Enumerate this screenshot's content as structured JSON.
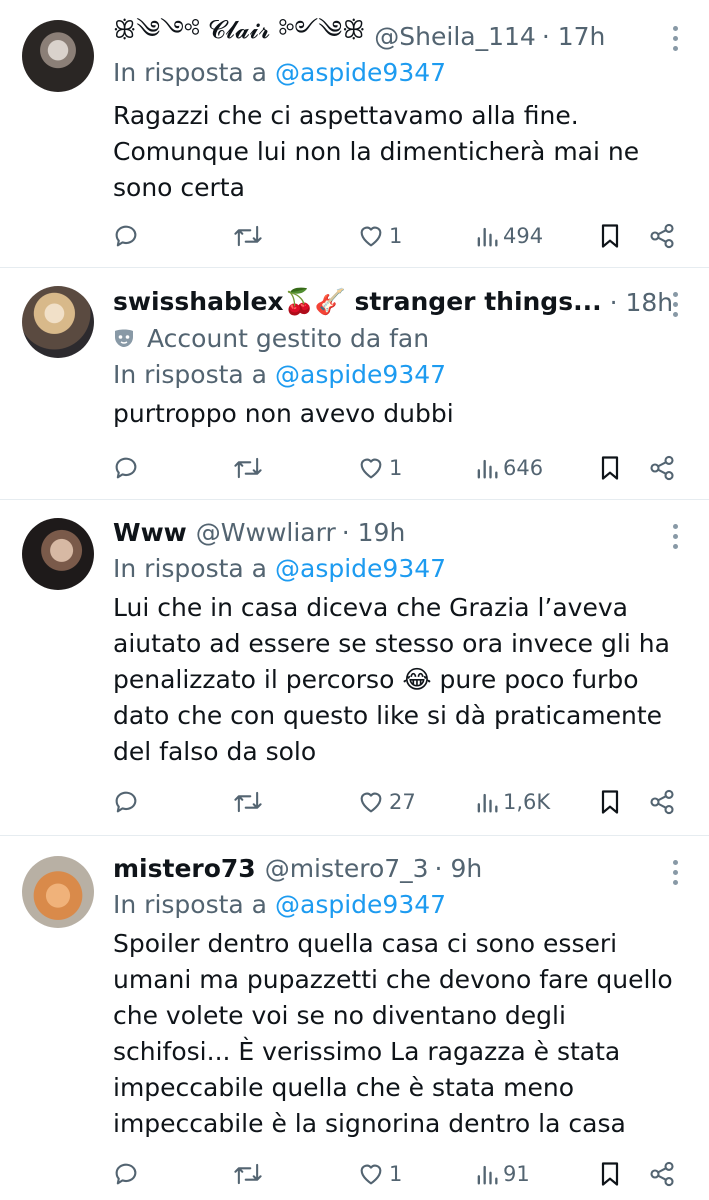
{
  "tweets": [
    {
      "name": "ꕥ༄༺ 𝓒𝓵𝓪𝓲𝓻 ༻༄ꕥ",
      "handle": "@Sheila_114",
      "time": "· 17h",
      "reply_prefix": "In risposta a",
      "reply_to": "@aspide9347",
      "text": "Ragazzi che ci aspettavamo alla fine.\nComunque lui non la dimenticherà mai ne sono certa",
      "likes": "1",
      "views": "494"
    },
    {
      "name": "swisshablex🍒🎸 stranger things...",
      "handle": "",
      "time": "· 18h",
      "fan_label": "Account gestito da fan",
      "reply_prefix": "In risposta a",
      "reply_to": "@aspide9347",
      "text": "purtroppo non avevo dubbi",
      "likes": "1",
      "views": "646"
    },
    {
      "name": "Www",
      "handle": "@Wwwliarr",
      "time": "· 19h",
      "reply_prefix": "In risposta a",
      "reply_to": "@aspide9347",
      "text": "Lui che in casa diceva che Grazia l’aveva aiutato ad essere se stesso ora invece gli ha penalizzato il percorso 😂 pure poco furbo dato che con questo like si dà praticamente del falso da solo",
      "likes": "27",
      "views": "1,6K"
    },
    {
      "name": "mistero73",
      "handle": "@mistero7_3",
      "time": "· 9h",
      "reply_prefix": "In risposta a",
      "reply_to": "@aspide9347",
      "text": "Spoiler dentro quella casa ci sono esseri umani ma pupazzetti che devono fare quello che volete voi se no diventano degli schifosi... È verissimo La ragazza è stata impeccabile quella che è stata meno impeccabile è la signorina dentro la casa",
      "likes": "1",
      "views": "91"
    }
  ],
  "colors": {
    "accent": "#1d9bf0",
    "muted": "#536471",
    "text": "#0f1419"
  },
  "icons": [
    "reply-icon",
    "retweet-icon",
    "like-icon",
    "views-icon",
    "bookmark-icon",
    "share-icon",
    "more-icon",
    "fan-mask-icon"
  ]
}
